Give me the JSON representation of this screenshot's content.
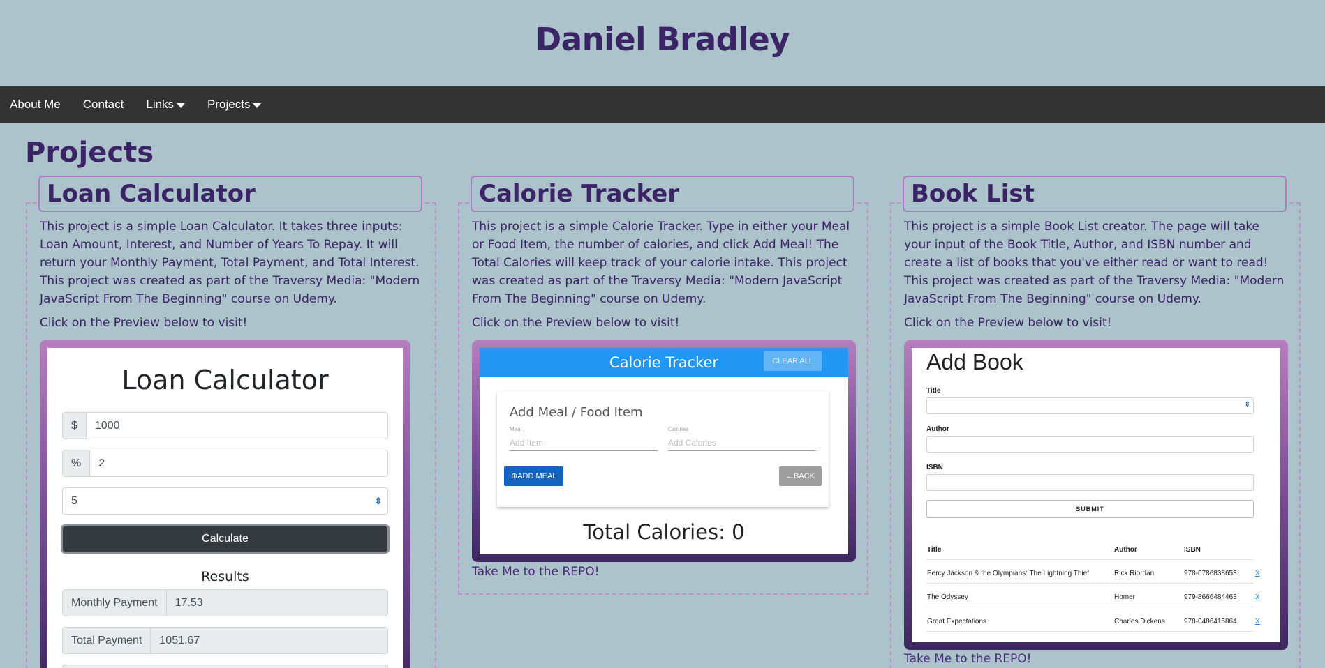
{
  "site": {
    "title": "Daniel Bradley"
  },
  "nav": {
    "items": [
      {
        "label": "About Me",
        "has_caret": false
      },
      {
        "label": "Contact",
        "has_caret": false
      },
      {
        "label": "Links",
        "has_caret": true
      },
      {
        "label": "Projects",
        "has_caret": true
      }
    ]
  },
  "page": {
    "heading": "Projects"
  },
  "projects": [
    {
      "title": "Loan Calculator",
      "description": "This project is a simple Loan Calculator. It takes three inputs: Loan Amount, Interest, and Number of Years To Repay. It will return your Monthly Payment, Total Payment, and Total Interest. This project was created as part of the Traversy Media: \"Modern JavaScript From The Beginning\" course on Udemy.",
      "click_text": "Click on the Preview below to visit!"
    },
    {
      "title": "Calorie Tracker",
      "description": "This project is a simple Calorie Tracker. Type in either your Meal or Food Item, the number of calories, and click Add Meal! The Total Calories will keep track of your calorie intake. This project was created as part of the Traversy Media: \"Modern JavaScript From The Beginning\" course on Udemy.",
      "click_text": "Click on the Preview below to visit!",
      "repo_link": "Take Me to the REPO!"
    },
    {
      "title": "Book List",
      "description": "This project is a simple Book List creator. The page will take your input of the Book Title, Author, and ISBN number and create a list of books that you've either read or want to read! This project was created as part of the Traversy Media: \"Modern JavaScript From The Beginning\" course on Udemy.",
      "click_text": "Click on the Preview below to visit!",
      "repo_link": "Take Me to the REPO!"
    }
  ],
  "loan_preview": {
    "title": "Loan Calculator",
    "amount_prefix": "$",
    "amount_value": "1000",
    "interest_prefix": "%",
    "interest_value": "2",
    "years_value": "5",
    "calculate_label": "Calculate",
    "results_heading": "Results",
    "monthly_label": "Monthly Payment",
    "monthly_value": "17.53",
    "total_label": "Total Payment",
    "total_value": "1051.67"
  },
  "calorie_preview": {
    "brand": "Calorie Tracker",
    "clear_all": "CLEAR ALL",
    "card_title": "Add Meal / Food Item",
    "meal_label": "Meal",
    "meal_placeholder": "Add Item",
    "calories_label": "Calories",
    "calories_placeholder": "Add Calories",
    "add_label": "ADD MEAL",
    "back_label": "BACK",
    "total": "Total Calories: 0"
  },
  "book_preview": {
    "title": "Add Book",
    "title_label": "Title",
    "author_label": "Author",
    "isbn_label": "ISBN",
    "submit_label": "SUBMIT",
    "table_headers": [
      "Title",
      "Author",
      "ISBN"
    ],
    "rows": [
      {
        "title": "Percy Jackson & the Olympians: The Lightning Thief",
        "author": "Rick Riordan",
        "isbn": "978-0786838653",
        "delete": "X"
      },
      {
        "title": "The Odyssey",
        "author": "Homer",
        "isbn": "979-8666484463",
        "delete": "X"
      },
      {
        "title": "Great Expectations",
        "author": "Charles Dickens",
        "isbn": "978-0486415864",
        "delete": "X"
      }
    ]
  },
  "colors": {
    "background": "#adc3cb",
    "navbar": "#333333",
    "heading": "#3b2466",
    "accent_border": "#b07ac6"
  }
}
